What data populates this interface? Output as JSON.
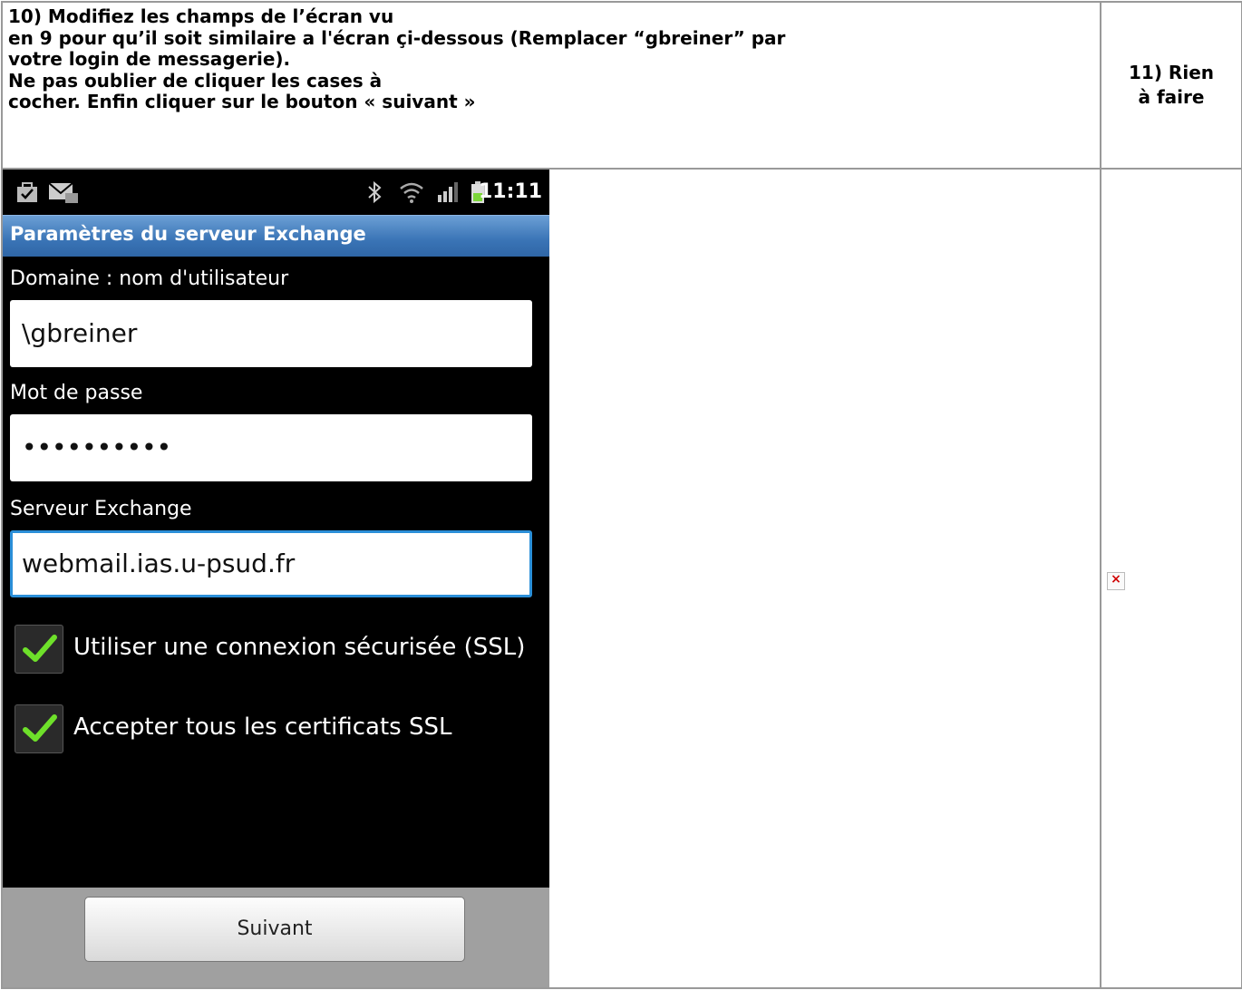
{
  "instructions": {
    "lines": [
      "10) Modifiez les champs de l’écran vu",
      "en 9 pour qu’il soit similaire a l'écran çi-dessous (Remplacer “gbreiner” par",
      "votre login de messagerie).",
      "Ne pas oublier de cliquer les cases à",
      "cocher. Enfin cliquer sur le bouton « suivant »"
    ],
    "step11_line1": "11) Rien",
    "step11_line2": "à faire"
  },
  "phone": {
    "clock": "11:11",
    "title": "Paramètres du serveur Exchange",
    "username_label": "Domaine : nom d'utilisateur",
    "username_value": "\\gbreiner",
    "password_label": "Mot de passe",
    "password_value": "••••••••••",
    "server_label": "Serveur Exchange",
    "server_value": "webmail.ias.u-psud.fr",
    "ssl_label": "Utiliser une connexion sécurisée (SSL)",
    "ssl_checked": true,
    "cert_label": "Accepter tous les certificats SSL",
    "cert_checked": true,
    "next_button": "Suivant"
  },
  "icons": {
    "broken_image": "broken-image-icon",
    "status": [
      "briefcase-icon",
      "mail-icon",
      "bluetooth-icon",
      "wifi-icon",
      "signal-icon",
      "battery-icon"
    ],
    "accent_color": "#2b8fd8",
    "check_color": "#6ee02a"
  }
}
